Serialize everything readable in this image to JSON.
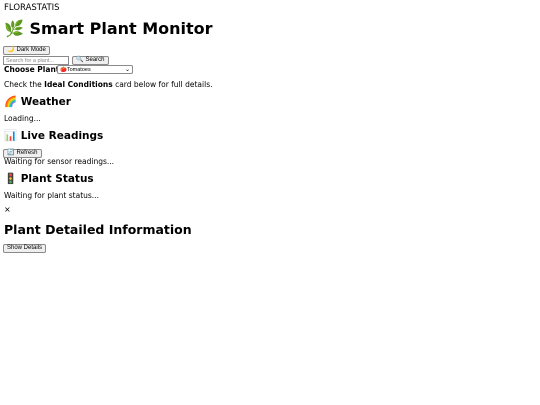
{
  "brand": "FLORASTATIS",
  "header": {
    "title_icon": "🌿",
    "title": "Smart Plant Monitor"
  },
  "dark_mode": {
    "icon": "🌙",
    "label": "Dark Mode"
  },
  "search": {
    "placeholder": "Search for a plant...",
    "value": "",
    "button_icon": "🔍",
    "button_label": "Search"
  },
  "plant_select": {
    "label": "Choose Plant:",
    "selected_icon": "🍅",
    "selected": "Tomatoes"
  },
  "intro": {
    "before": "Check the ",
    "strong": "Ideal Conditions",
    "after": " card below for full details."
  },
  "weather": {
    "icon": "🌈",
    "title": "Weather",
    "status": "Loading..."
  },
  "live": {
    "icon": "📊",
    "title": "Live Readings",
    "refresh_icon": "🔄",
    "refresh_label": "Refresh",
    "status": "Waiting for sensor readings..."
  },
  "plant_status": {
    "icon": "🚦",
    "title": "Plant Status",
    "status": "Waiting for plant status..."
  },
  "close_symbol": "×",
  "details": {
    "title": "Plant Detailed Information",
    "button_label": "Show Details"
  }
}
